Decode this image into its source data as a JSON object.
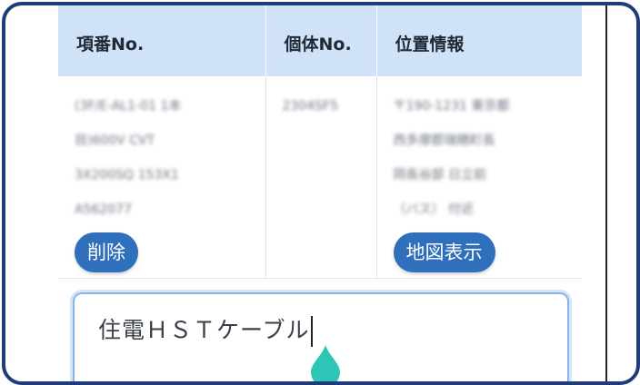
{
  "table": {
    "headers": [
      "項番No.",
      "個体No.",
      "位置情報"
    ],
    "row": {
      "item_text": "(3F/E-AL1-01 1本\n目)600V CVT\n3X200SQ 153X1\nA562077",
      "individual_no": "2304SF5",
      "location_text": "〒190-1231 東京都\n西多摩郡瑞穂町長\n岡長谷部 日立前\n（バス） 付近",
      "delete_label": "削除",
      "map_label": "地図表示"
    }
  },
  "input": {
    "value": "住電ＨＳＴケーブル"
  },
  "colors": {
    "frame": "#1e3c78",
    "header_bg": "#cfe2f8",
    "button_bg": "#2f6fbc",
    "handle": "#2ec4b6"
  }
}
